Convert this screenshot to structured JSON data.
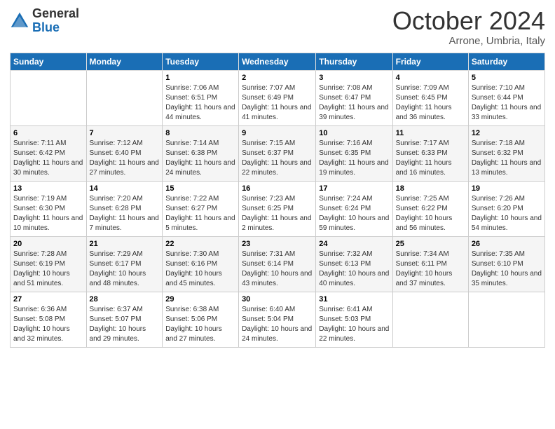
{
  "logo": {
    "general": "General",
    "blue": "Blue"
  },
  "header": {
    "month": "October 2024",
    "location": "Arrone, Umbria, Italy"
  },
  "weekdays": [
    "Sunday",
    "Monday",
    "Tuesday",
    "Wednesday",
    "Thursday",
    "Friday",
    "Saturday"
  ],
  "weeks": [
    [
      {
        "day": "",
        "info": ""
      },
      {
        "day": "",
        "info": ""
      },
      {
        "day": "1",
        "sunrise": "Sunrise: 7:06 AM",
        "sunset": "Sunset: 6:51 PM",
        "daylight": "Daylight: 11 hours and 44 minutes."
      },
      {
        "day": "2",
        "sunrise": "Sunrise: 7:07 AM",
        "sunset": "Sunset: 6:49 PM",
        "daylight": "Daylight: 11 hours and 41 minutes."
      },
      {
        "day": "3",
        "sunrise": "Sunrise: 7:08 AM",
        "sunset": "Sunset: 6:47 PM",
        "daylight": "Daylight: 11 hours and 39 minutes."
      },
      {
        "day": "4",
        "sunrise": "Sunrise: 7:09 AM",
        "sunset": "Sunset: 6:45 PM",
        "daylight": "Daylight: 11 hours and 36 minutes."
      },
      {
        "day": "5",
        "sunrise": "Sunrise: 7:10 AM",
        "sunset": "Sunset: 6:44 PM",
        "daylight": "Daylight: 11 hours and 33 minutes."
      }
    ],
    [
      {
        "day": "6",
        "sunrise": "Sunrise: 7:11 AM",
        "sunset": "Sunset: 6:42 PM",
        "daylight": "Daylight: 11 hours and 30 minutes."
      },
      {
        "day": "7",
        "sunrise": "Sunrise: 7:12 AM",
        "sunset": "Sunset: 6:40 PM",
        "daylight": "Daylight: 11 hours and 27 minutes."
      },
      {
        "day": "8",
        "sunrise": "Sunrise: 7:14 AM",
        "sunset": "Sunset: 6:38 PM",
        "daylight": "Daylight: 11 hours and 24 minutes."
      },
      {
        "day": "9",
        "sunrise": "Sunrise: 7:15 AM",
        "sunset": "Sunset: 6:37 PM",
        "daylight": "Daylight: 11 hours and 22 minutes."
      },
      {
        "day": "10",
        "sunrise": "Sunrise: 7:16 AM",
        "sunset": "Sunset: 6:35 PM",
        "daylight": "Daylight: 11 hours and 19 minutes."
      },
      {
        "day": "11",
        "sunrise": "Sunrise: 7:17 AM",
        "sunset": "Sunset: 6:33 PM",
        "daylight": "Daylight: 11 hours and 16 minutes."
      },
      {
        "day": "12",
        "sunrise": "Sunrise: 7:18 AM",
        "sunset": "Sunset: 6:32 PM",
        "daylight": "Daylight: 11 hours and 13 minutes."
      }
    ],
    [
      {
        "day": "13",
        "sunrise": "Sunrise: 7:19 AM",
        "sunset": "Sunset: 6:30 PM",
        "daylight": "Daylight: 11 hours and 10 minutes."
      },
      {
        "day": "14",
        "sunrise": "Sunrise: 7:20 AM",
        "sunset": "Sunset: 6:28 PM",
        "daylight": "Daylight: 11 hours and 7 minutes."
      },
      {
        "day": "15",
        "sunrise": "Sunrise: 7:22 AM",
        "sunset": "Sunset: 6:27 PM",
        "daylight": "Daylight: 11 hours and 5 minutes."
      },
      {
        "day": "16",
        "sunrise": "Sunrise: 7:23 AM",
        "sunset": "Sunset: 6:25 PM",
        "daylight": "Daylight: 11 hours and 2 minutes."
      },
      {
        "day": "17",
        "sunrise": "Sunrise: 7:24 AM",
        "sunset": "Sunset: 6:24 PM",
        "daylight": "Daylight: 10 hours and 59 minutes."
      },
      {
        "day": "18",
        "sunrise": "Sunrise: 7:25 AM",
        "sunset": "Sunset: 6:22 PM",
        "daylight": "Daylight: 10 hours and 56 minutes."
      },
      {
        "day": "19",
        "sunrise": "Sunrise: 7:26 AM",
        "sunset": "Sunset: 6:20 PM",
        "daylight": "Daylight: 10 hours and 54 minutes."
      }
    ],
    [
      {
        "day": "20",
        "sunrise": "Sunrise: 7:28 AM",
        "sunset": "Sunset: 6:19 PM",
        "daylight": "Daylight: 10 hours and 51 minutes."
      },
      {
        "day": "21",
        "sunrise": "Sunrise: 7:29 AM",
        "sunset": "Sunset: 6:17 PM",
        "daylight": "Daylight: 10 hours and 48 minutes."
      },
      {
        "day": "22",
        "sunrise": "Sunrise: 7:30 AM",
        "sunset": "Sunset: 6:16 PM",
        "daylight": "Daylight: 10 hours and 45 minutes."
      },
      {
        "day": "23",
        "sunrise": "Sunrise: 7:31 AM",
        "sunset": "Sunset: 6:14 PM",
        "daylight": "Daylight: 10 hours and 43 minutes."
      },
      {
        "day": "24",
        "sunrise": "Sunrise: 7:32 AM",
        "sunset": "Sunset: 6:13 PM",
        "daylight": "Daylight: 10 hours and 40 minutes."
      },
      {
        "day": "25",
        "sunrise": "Sunrise: 7:34 AM",
        "sunset": "Sunset: 6:11 PM",
        "daylight": "Daylight: 10 hours and 37 minutes."
      },
      {
        "day": "26",
        "sunrise": "Sunrise: 7:35 AM",
        "sunset": "Sunset: 6:10 PM",
        "daylight": "Daylight: 10 hours and 35 minutes."
      }
    ],
    [
      {
        "day": "27",
        "sunrise": "Sunrise: 6:36 AM",
        "sunset": "Sunset: 5:08 PM",
        "daylight": "Daylight: 10 hours and 32 minutes."
      },
      {
        "day": "28",
        "sunrise": "Sunrise: 6:37 AM",
        "sunset": "Sunset: 5:07 PM",
        "daylight": "Daylight: 10 hours and 29 minutes."
      },
      {
        "day": "29",
        "sunrise": "Sunrise: 6:38 AM",
        "sunset": "Sunset: 5:06 PM",
        "daylight": "Daylight: 10 hours and 27 minutes."
      },
      {
        "day": "30",
        "sunrise": "Sunrise: 6:40 AM",
        "sunset": "Sunset: 5:04 PM",
        "daylight": "Daylight: 10 hours and 24 minutes."
      },
      {
        "day": "31",
        "sunrise": "Sunrise: 6:41 AM",
        "sunset": "Sunset: 5:03 PM",
        "daylight": "Daylight: 10 hours and 22 minutes."
      },
      {
        "day": "",
        "info": ""
      },
      {
        "day": "",
        "info": ""
      }
    ]
  ]
}
